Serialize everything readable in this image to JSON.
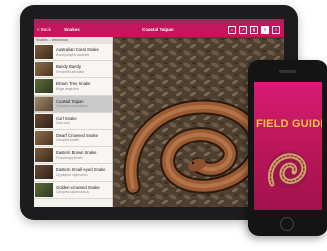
{
  "tablet": {
    "nav": {
      "back_label": "< Back",
      "left_title": "Snakes",
      "main_title": "Coastal Taipan",
      "icons": [
        "home-icon",
        "share-icon",
        "bookmark-icon",
        "search-icon",
        "list-icon"
      ]
    },
    "list": {
      "header": "Snakes – venomous",
      "items": [
        {
          "name": "Australian Coral Snake",
          "sci": "Brachyurophis australis"
        },
        {
          "name": "Bandy Bandy",
          "sci": "Vermicella annulata"
        },
        {
          "name": "Brown Tree Snake",
          "sci": "Boiga irregularis"
        },
        {
          "name": "Coastal Taipan",
          "sci": "Oxyuranus scutellatus",
          "selected": true
        },
        {
          "name": "Curl Snake",
          "sci": "Suta suta"
        },
        {
          "name": "Dwarf Crowned Snake",
          "sci": "Cacophis krefftii"
        },
        {
          "name": "Eastern Brown Snake",
          "sci": "Pseudonaja textilis"
        },
        {
          "name": "Eastern Small-eyed Snake",
          "sci": "Cryptophis nigrescens"
        },
        {
          "name": "Golden-crowned Snake",
          "sci": "Cacophis squamulosus"
        }
      ]
    }
  },
  "phone": {
    "heading": "FIELD GUIDE"
  }
}
